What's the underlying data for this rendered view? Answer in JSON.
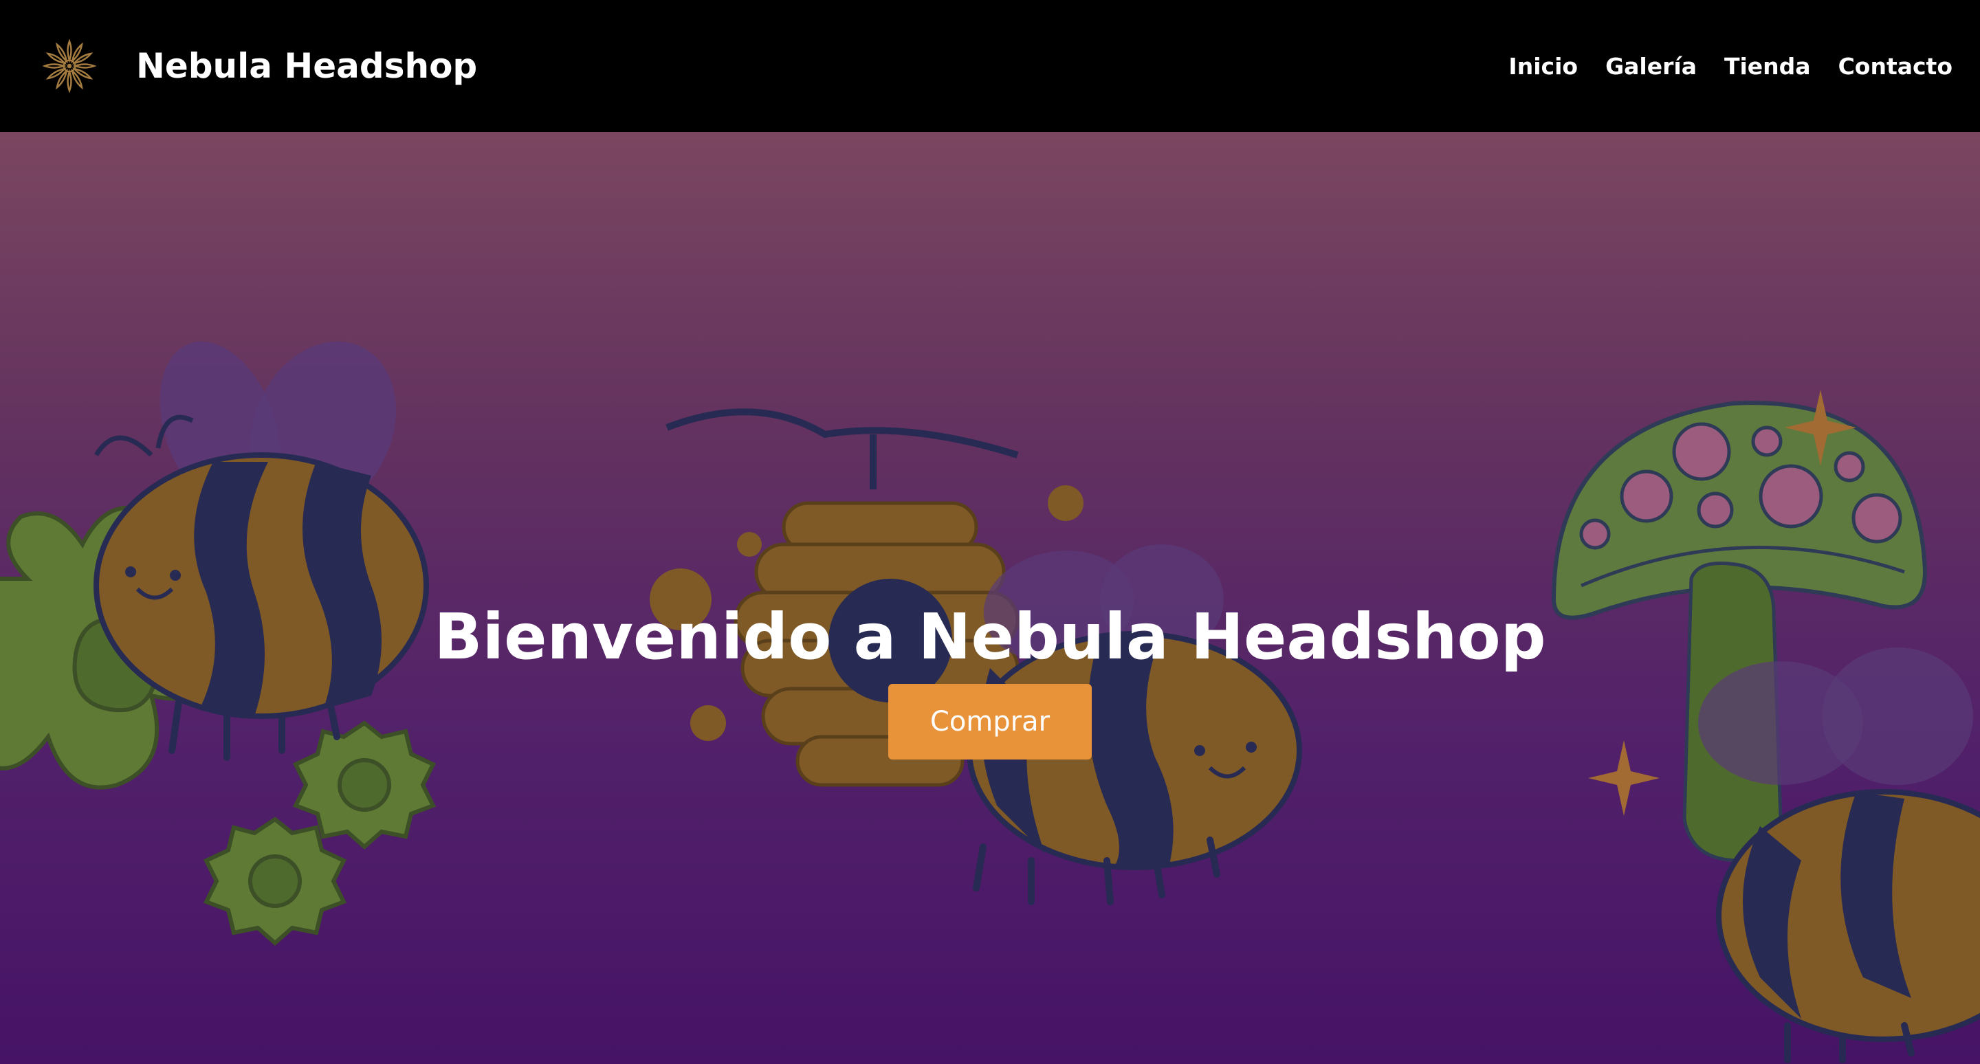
{
  "brand": {
    "name": "Nebula Headshop",
    "logo_icon": "sunflower-mandala-icon"
  },
  "nav": {
    "items": [
      {
        "label": "Inicio"
      },
      {
        "label": "Galería"
      },
      {
        "label": "Tienda"
      },
      {
        "label": "Contacto"
      }
    ]
  },
  "hero": {
    "title": "Bienvenido a Nebula Headshop",
    "cta_label": "Comprar",
    "illustration_icons": [
      "bee-icon",
      "flower-icon",
      "beehive-icon",
      "mushroom-icon",
      "sparkle-icon"
    ]
  },
  "colors": {
    "navbar_bg": "#000000",
    "hero_gradient_top": "#7a4660",
    "hero_gradient_bottom": "#461366",
    "cta_bg": "#e8923a",
    "bee_stripe_dark": "#272a52",
    "bee_stripe_gold": "#7f5a26",
    "flower_green": "#5e7a35",
    "mushroom_cap": "#5f7a3e",
    "spot_pink": "#9c5c7e"
  }
}
